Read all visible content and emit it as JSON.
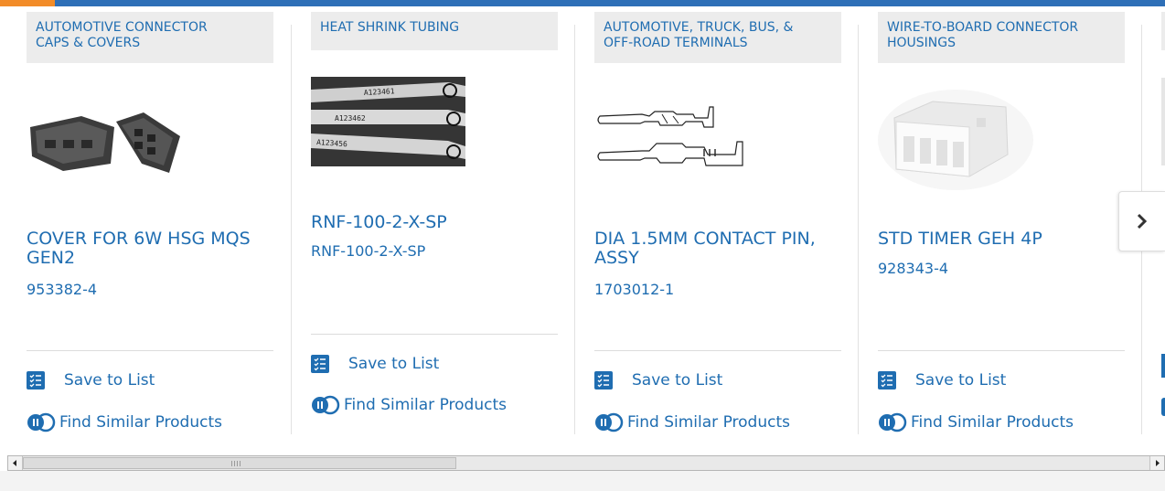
{
  "brand": {
    "accent_color": "#f28c28",
    "bar_color": "#2e6fb7",
    "link_color": "#1f6db1"
  },
  "cards": [
    {
      "category_lines": [
        "AUTOMOTIVE CONNECTOR",
        "CAPS & COVERS"
      ],
      "title": "COVER FOR 6W HSG MQS GEN2",
      "part_number": "953382-4",
      "image_icon": "connector-cover-image",
      "save_label": "Save to List",
      "similar_label": "Find Similar Products"
    },
    {
      "category_lines": [
        "HEAT SHRINK TUBING"
      ],
      "title": "RNF-100-2-X-SP",
      "part_number": "RNF-100-2-X-SP",
      "image_icon": "heat-shrink-tubing-image",
      "image_text": [
        "A123461",
        "A123462",
        "A123456"
      ],
      "save_label": "Save to List",
      "similar_label": "Find Similar Products"
    },
    {
      "category_lines": [
        "AUTOMOTIVE, TRUCK, BUS, &",
        "OFF-ROAD TERMINALS"
      ],
      "title": "DIA 1.5MM CONTACT PIN, ASSY",
      "part_number": "1703012-1",
      "image_icon": "contact-pin-drawing",
      "save_label": "Save to List",
      "similar_label": "Find Similar Products"
    },
    {
      "category_lines": [
        "WIRE-TO-BOARD CONNECTOR",
        "HOUSINGS"
      ],
      "title": "STD TIMER GEH 4P",
      "part_number": "928343-4",
      "image_icon": "white-connector-housing-image",
      "save_label": "Save to List",
      "similar_label": "Find Similar Products"
    }
  ],
  "carousel": {
    "next_icon": "chevron-right-icon"
  },
  "scrollbar": {
    "left_icon": "arrow-left-icon",
    "right_icon": "arrow-right-icon"
  }
}
